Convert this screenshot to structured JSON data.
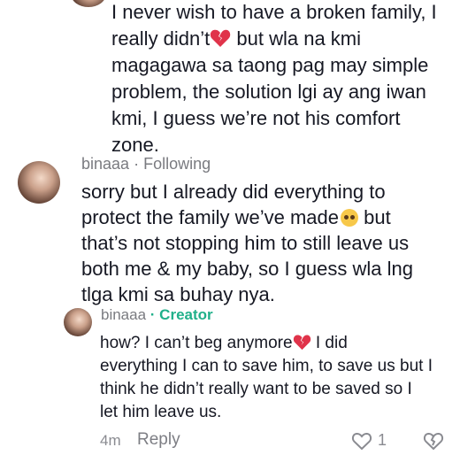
{
  "comment_top": {
    "lines": [
      "I never wish to have a broken family, I",
      "really didn’t",
      " but wla na kmi",
      "magagawa sa taong pag may simple",
      "problem, the solution lgi ay ang iwan",
      "kmi, I guess we’re not his comfort",
      "zone."
    ]
  },
  "comment_main": {
    "username": "binaaa",
    "relation": "· Following",
    "lines": [
      "sorry but I already did everything to",
      "protect the family we’ve made",
      " but",
      "that’s not stopping him to still leave us",
      "both me & my baby, so I guess wla lng",
      "tlga kmi sa buhay nya."
    ]
  },
  "reply": {
    "username": "binaaa",
    "badge": "· Creator",
    "lines": [
      "how? I can’t beg anymore",
      " I did",
      "everything I can to save him, to save us but I",
      "think he didn’t really want to be saved so I",
      "let him leave us."
    ],
    "time": "4m",
    "reply_label": "Reply",
    "likes": "1"
  },
  "colors": {
    "text": "#161823",
    "meta": "#7a7b80",
    "creator": "#20b08a",
    "heart": "#e0334a"
  },
  "icons": {
    "broken_heart": "broken-heart-icon",
    "pleading_face": "pleading-face-icon",
    "like": "heart-outline-icon",
    "dislike": "dislike-icon"
  }
}
